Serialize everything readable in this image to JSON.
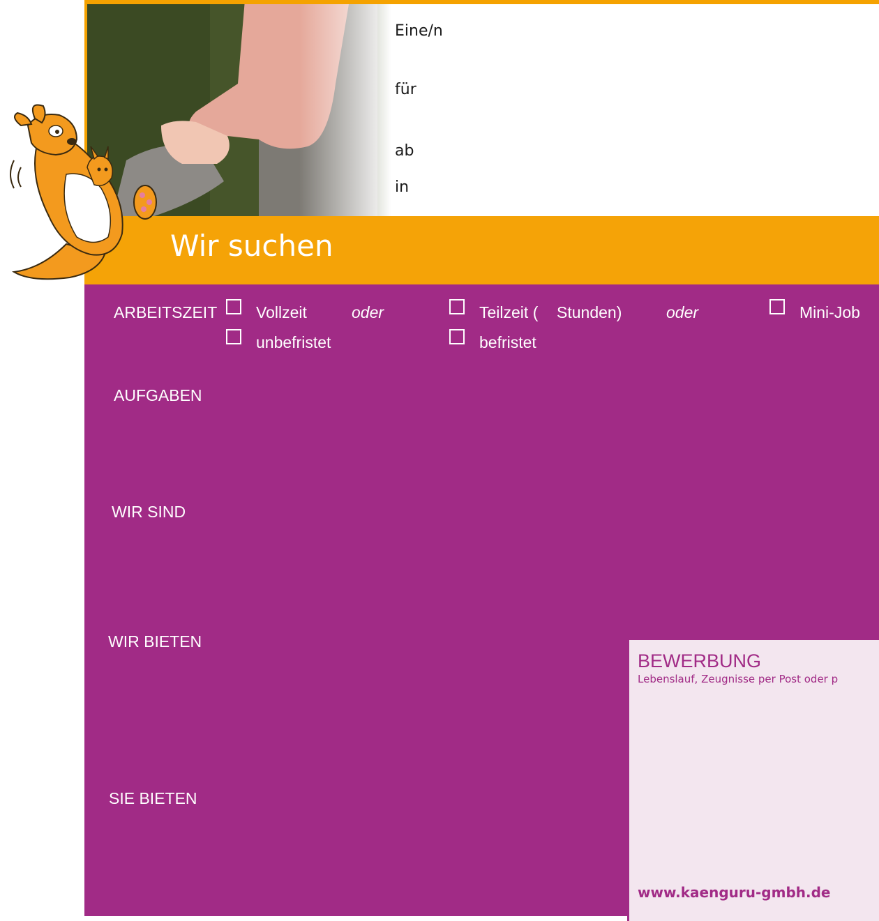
{
  "header": {
    "fields": [
      "Eine/n",
      "für",
      "ab",
      "in"
    ]
  },
  "band": {
    "title": "Wir suchen"
  },
  "arbeitszeit": {
    "label": "ARBEITSZEIT",
    "row1": {
      "opt1": "Vollzeit",
      "oder1": "oder",
      "opt2_prefix": "Teilzeit (",
      "opt2_suffix": "Stunden)",
      "oder2": "oder",
      "opt3": "Mini-Job"
    },
    "row2": {
      "opt1": "unbefristet",
      "opt2": "befristet"
    }
  },
  "sections": {
    "aufgaben": "AUFGABEN",
    "wir_sind": "WIR SIND",
    "wir_bieten": "WIR BIETEN",
    "sie_bieten": "SIE BIETEN"
  },
  "bewerbung": {
    "title": "BEWERBUNG",
    "text": "Lebenslauf, Zeugnisse per Post oder p",
    "url": "www.kaenguru-gmbh.de"
  },
  "icons": {
    "mascot": "kangaroo-mascot-icon",
    "photo": "holding-hands-photo"
  },
  "colors": {
    "orange": "#f5a307",
    "purple": "#a12b86",
    "light_pink": "#f3e6ef"
  }
}
